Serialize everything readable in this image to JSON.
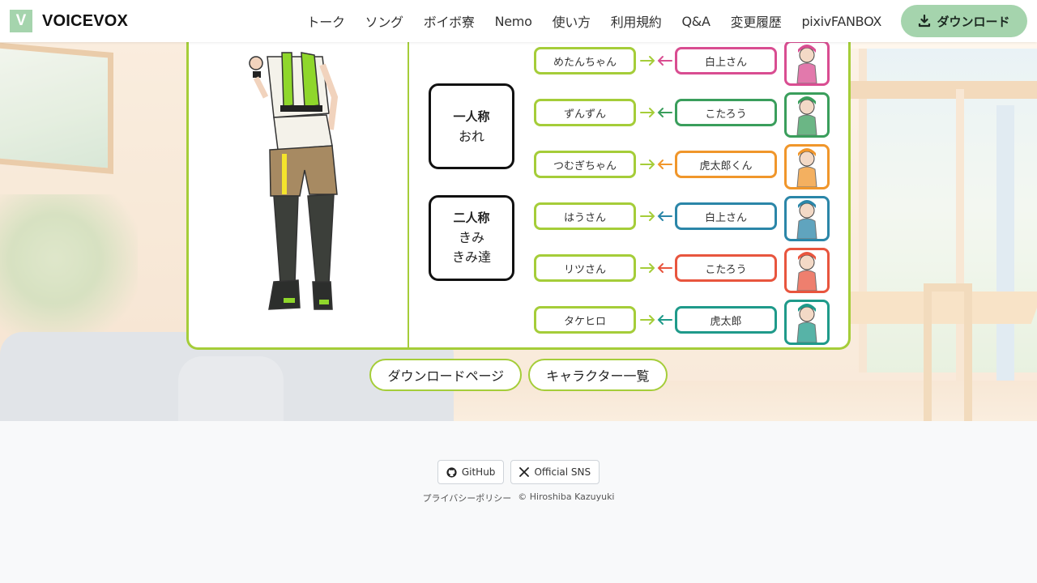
{
  "header": {
    "logo_letter": "V",
    "brand": "VOICEVOX",
    "nav": [
      "トーク",
      "ソング",
      "ボイボ寮",
      "Nemo",
      "使い方",
      "利用規約",
      "Q&A",
      "変更履歴",
      "pixivFANBOX"
    ],
    "download_label": "ダウンロード",
    "accent_color": "#a5d4ad"
  },
  "panel": {
    "border_color": "#a5cd39",
    "first_person": {
      "title": "一人称",
      "values": [
        "おれ"
      ]
    },
    "second_person": {
      "title": "二人称",
      "values": [
        "きみ",
        "きみ達"
      ]
    },
    "rows": [
      {
        "left": "めたんちゃん",
        "right": "白上さん",
        "color": "#d94d91",
        "avatar": "character-avatar-pink"
      },
      {
        "left": "ずんずん",
        "right": "こたろう",
        "color": "#3a9e5c",
        "avatar": "character-avatar-green"
      },
      {
        "left": "つむぎちゃん",
        "right": "虎太郎くん",
        "color": "#f0962b",
        "avatar": "character-avatar-orange"
      },
      {
        "left": "はうさん",
        "right": "白上さん",
        "color": "#2b86a8",
        "avatar": "character-avatar-blue"
      },
      {
        "left": "リツさん",
        "right": "こたろう",
        "color": "#e8553e",
        "avatar": "character-avatar-red"
      },
      {
        "left": "タケヒロ",
        "right": "虎太郎",
        "color": "#1f9a8a",
        "avatar": "character-avatar-teal"
      }
    ]
  },
  "cta": {
    "download_page": "ダウンロードページ",
    "character_list": "キャラクター一覧"
  },
  "footer": {
    "github": "GitHub",
    "sns": "Official SNS",
    "privacy": "プライバシーポリシー",
    "copyright": "© Hiroshiba Kazuyuki"
  }
}
